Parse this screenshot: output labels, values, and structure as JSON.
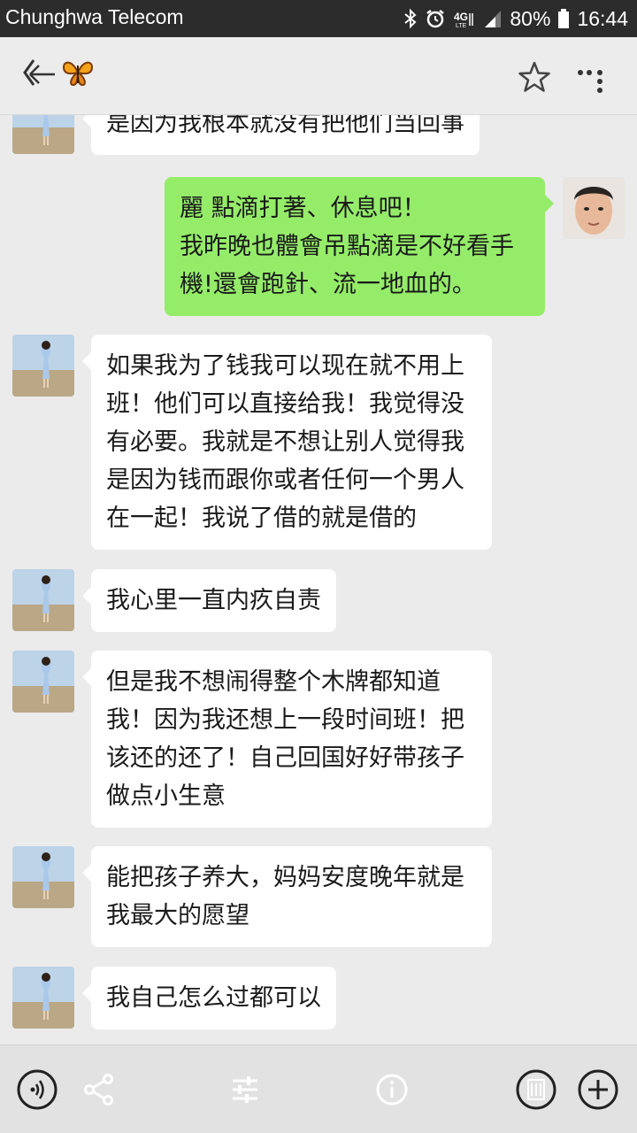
{
  "status_bar": {
    "carrier": "Chunghwa Telecom",
    "battery": "80%",
    "time": "16:44",
    "network": "4G"
  },
  "header": {
    "contact_icon": "butterfly-emoji",
    "back_icon": "back-arrow-icon",
    "star_icon": "star-icon",
    "more_icon": "more-icon"
  },
  "messages": [
    {
      "side": "in",
      "text": "是因为我根本就没有把他们当回事"
    },
    {
      "side": "out",
      "text": "麗 點滴打著、休息吧！\n我昨晚也體會吊點滴是不好看手\n機!還會跑針、流一地血的。"
    },
    {
      "side": "in",
      "text": "如果我为了钱我可以现在就不用上\n班！他们可以直接给我！我觉得没\n有必要。我就是不想让别人觉得我\n是因为钱而跟你或者任何一个男人\n在一起！我说了借的就是借的"
    },
    {
      "side": "in",
      "text": "我心里一直内疚自责"
    },
    {
      "side": "in",
      "text": "但是我不想闹得整个木牌都知道\n我！因为我还想上一段时间班！把\n该还的还了！自己回国好好带孩子\n做点小生意"
    },
    {
      "side": "in",
      "text": "能把孩子养大，妈妈安度晚年就是\n我最大的愿望"
    },
    {
      "side": "in",
      "text": "我自己怎么过都可以"
    }
  ],
  "bottom_bar": {
    "icons": [
      "voice-icon",
      "share-icon",
      "adjust-icon",
      "info-icon",
      "delete-icon",
      "add-icon"
    ]
  },
  "colors": {
    "outgoing_bubble": "#95ec69",
    "incoming_bubble": "#ffffff",
    "chat_background": "#ebebeb",
    "status_bar": "#2c2c2c"
  }
}
